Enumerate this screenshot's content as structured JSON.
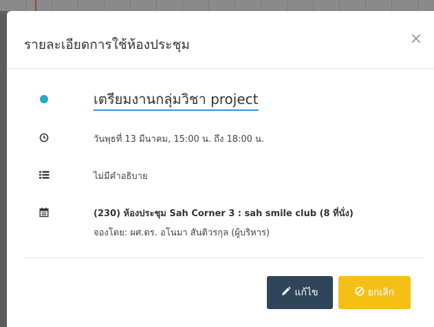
{
  "modal": {
    "title": "รายละเอียดการใช้ห้องประชุม",
    "close_symbol": "×"
  },
  "event": {
    "status_color": "#2aa8c7",
    "title": "เตรียมงานกลุ่มวิชา project",
    "datetime": "วันพุธที่ 13 มีนาคม, 15:00 น. ถึง 18:00 น.",
    "description": "ไม่มีคำอธิบาย",
    "room": "(230) ห้องประชุม Sah Corner 3 : sah smile club (8 ที่นั่ง)",
    "booked_by": "จองโดย: ผศ.ดร. อโนมา สันติวรกุล (ผู้บริหาร)"
  },
  "icons": {
    "status": "status-dot-icon",
    "time": "clock-icon",
    "description": "list-icon",
    "room": "calendar-icon"
  },
  "buttons": {
    "edit_label": "แก้ไข",
    "edit_icon": "pencil-icon",
    "edit_color": "#2f4559",
    "cancel_label": "ยกเลิก",
    "cancel_icon": "ban-icon",
    "cancel_color": "#f5c016"
  }
}
